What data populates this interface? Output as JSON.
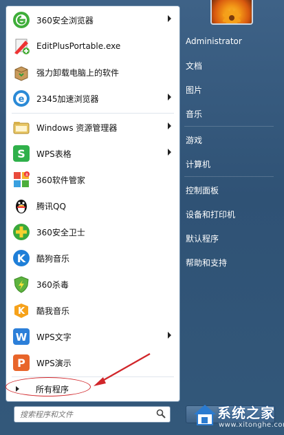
{
  "start_menu": {
    "programs": [
      {
        "label": "360安全浏览器",
        "has_submenu": true,
        "icon": "360-browser-icon"
      },
      {
        "label": "EditPlusPortable.exe",
        "has_submenu": false,
        "icon": "editplus-icon"
      },
      {
        "label": "强力卸载电脑上的软件",
        "has_submenu": false,
        "icon": "uninstall-box-icon"
      },
      {
        "label": "2345加速浏览器",
        "has_submenu": true,
        "icon": "2345-browser-icon"
      },
      {
        "label": "Windows 资源管理器",
        "has_submenu": true,
        "icon": "explorer-folder-icon"
      },
      {
        "label": "WPS表格",
        "has_submenu": true,
        "icon": "wps-spreadsheet-icon"
      },
      {
        "label": "360软件管家",
        "has_submenu": false,
        "icon": "360-software-manager-icon"
      },
      {
        "label": "腾讯QQ",
        "has_submenu": false,
        "icon": "qq-penguin-icon"
      },
      {
        "label": "360安全卫士",
        "has_submenu": false,
        "icon": "360-security-guard-icon"
      },
      {
        "label": "酷狗音乐",
        "has_submenu": false,
        "icon": "kugou-music-icon"
      },
      {
        "label": "360杀毒",
        "has_submenu": false,
        "icon": "360-antivirus-icon"
      },
      {
        "label": "酷我音乐",
        "has_submenu": false,
        "icon": "kuwo-music-icon"
      },
      {
        "label": "WPS文字",
        "has_submenu": true,
        "icon": "wps-writer-icon"
      },
      {
        "label": "WPS演示",
        "has_submenu": false,
        "icon": "wps-presentation-icon"
      }
    ],
    "all_programs_label": "所有程序",
    "search_placeholder": "搜索程序和文件",
    "right_items": [
      {
        "label": "Administrator"
      },
      {
        "label": "文档"
      },
      {
        "label": "图片"
      },
      {
        "label": "音乐"
      },
      {
        "label": "游戏"
      },
      {
        "label": "计算机"
      },
      {
        "label": "控制面板"
      },
      {
        "label": "设备和打印机"
      },
      {
        "label": "默认程序"
      },
      {
        "label": "帮助和支持"
      }
    ]
  },
  "watermark": {
    "title": "系统之家",
    "url": "www.xitonghe.com"
  },
  "colors": {
    "panel_bg": "#3e6287",
    "left_bg": "#ffffff",
    "annotation_red": "#d1262a"
  }
}
